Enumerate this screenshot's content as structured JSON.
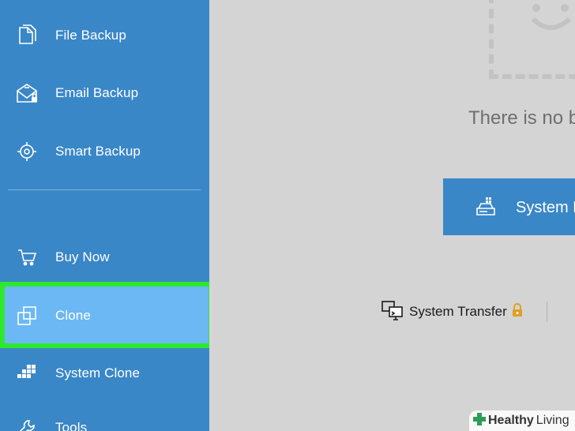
{
  "sidebar": {
    "items": [
      {
        "label": "File Backup",
        "icon": "file-backup-icon"
      },
      {
        "label": "Email Backup",
        "icon": "email-backup-icon"
      },
      {
        "label": "Smart Backup",
        "icon": "smart-backup-icon"
      },
      {
        "label": "Buy Now",
        "icon": "cart-icon"
      },
      {
        "label": "Clone",
        "icon": "clone-icon"
      },
      {
        "label": "System Clone",
        "icon": "system-clone-icon"
      },
      {
        "label": "Tools",
        "icon": "tools-icon"
      }
    ],
    "active": "Clone"
  },
  "main": {
    "empty_text": "There is no b",
    "system_button_label": "System B",
    "transfer_label": "System Transfer"
  },
  "watermark": {
    "brand_bold": "Healthy",
    "brand_rest": "Living"
  },
  "colors": {
    "sidebar": "#3a87c8",
    "active": "#6cb8f5",
    "highlight": "#2ee82e",
    "content_bg": "#d4d4d4",
    "lock": "#e0a020"
  }
}
